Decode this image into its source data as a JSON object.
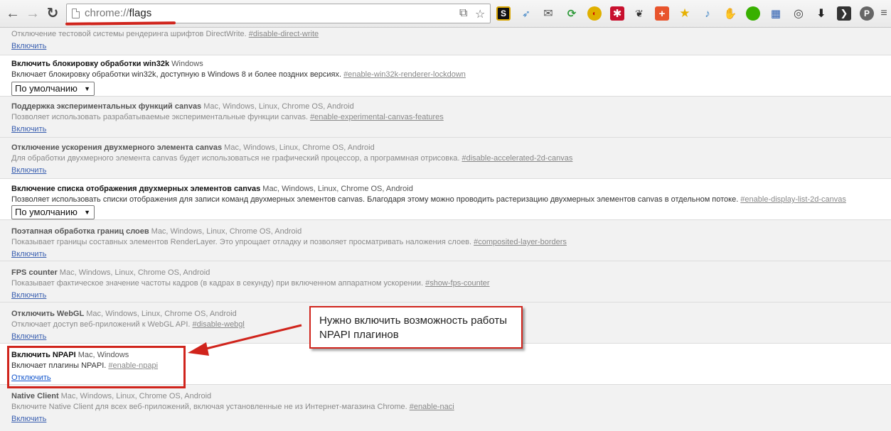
{
  "toolbar": {
    "url_scheme": "chrome://",
    "url_path": "flags"
  },
  "experiments": [
    {
      "name": "",
      "platforms": "",
      "description": "Отключение тестовой системы рендеринга шрифтов DirectWrite.",
      "tag": "#disable-direct-write",
      "action_label": "Включить",
      "state": "disabled"
    },
    {
      "name": "Включить блокировку обработки win32k",
      "platforms": "Windows",
      "description": "Включает блокировку обработки win32k, доступную в Windows 8 и более поздних версиях.",
      "tag": "#enable-win32k-renderer-lockdown",
      "select_value": "По умолчанию",
      "state": "enabled"
    },
    {
      "name": "Поддержка экспериментальных функций canvas",
      "platforms": "Mac, Windows, Linux, Chrome OS, Android",
      "description": "Позволяет использовать разрабатываемые экспериментальные функции canvas.",
      "tag": "#enable-experimental-canvas-features",
      "action_label": "Включить",
      "state": "disabled"
    },
    {
      "name": "Отключение ускорения двухмерного элемента canvas",
      "platforms": "Mac, Windows, Linux, Chrome OS, Android",
      "description": "Для обработки двухмерного элемента canvas будет использоваться не графический процессор, а программная отрисовка.",
      "tag": "#disable-accelerated-2d-canvas",
      "action_label": "Включить",
      "state": "disabled"
    },
    {
      "name": "Включение списка отображения двухмерных элементов canvas",
      "platforms": "Mac, Windows, Linux, Chrome OS, Android",
      "description": "Позволяет использовать списки отображения для записи команд двухмерных элементов canvas. Благодаря этому можно проводить растеризацию двухмерных элементов canvas в отдельном потоке.",
      "tag": "#enable-display-list-2d-canvas",
      "select_value": "По умолчанию",
      "state": "enabled"
    },
    {
      "name": "Поэтапная обработка границ слоев",
      "platforms": "Mac, Windows, Linux, Chrome OS, Android",
      "description": "Показывает границы составных элементов RenderLayer. Это упрощает отладку и позволяет просматривать наложения слоев.",
      "tag": "#composited-layer-borders",
      "action_label": "Включить",
      "state": "disabled"
    },
    {
      "name": "FPS counter",
      "platforms": "Mac, Windows, Linux, Chrome OS, Android",
      "description": "Показывает фактическое значение частоты кадров (в кадрах в секунду) при включенном аппаратном ускорении.",
      "tag": "#show-fps-counter",
      "action_label": "Включить",
      "state": "disabled"
    },
    {
      "name": "Отключить WebGL",
      "platforms": "Mac, Windows, Linux, Chrome OS, Android",
      "description": "Отключает доступ веб-приложений к WebGL API.",
      "tag": "#disable-webgl",
      "action_label": "Включить",
      "state": "disabled"
    },
    {
      "name": "Включить NPAPI",
      "platforms": "Mac, Windows",
      "description": "Включает плагины NPAPI.",
      "tag": "#enable-npapi",
      "action_label": "Отключить",
      "state": "enabled"
    },
    {
      "name": "Native Client",
      "platforms": "Mac, Windows, Linux, Chrome OS, Android",
      "description": "Включите Native Client для всех веб-приложений, включая установленные не из Интернет-магазина Chrome.",
      "tag": "#enable-naci",
      "action_label": "Включить",
      "state": "disabled"
    }
  ],
  "annotation": {
    "text": "Нужно включить возможность работы NPAPI плагинов",
    "color": "#d0241c"
  }
}
